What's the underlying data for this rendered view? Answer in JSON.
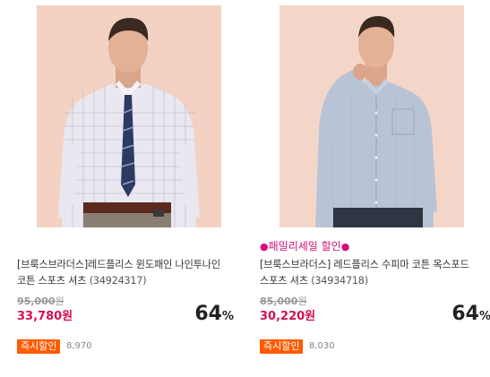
{
  "products": [
    {
      "promo_tag": "",
      "title": "[브룩스브라더스]레드플리스 윈도패인 나인투나인 코튼 스포츠 셔츠",
      "code": "(34924317)",
      "original_price": "95,000",
      "original_currency": "원",
      "sale_price": "33,780원",
      "discount_value": "64",
      "discount_unit": "%",
      "badge": "즉시할인",
      "review_count": "8,970",
      "image_desc": "man-in-check-shirt-and-tie"
    },
    {
      "promo_tag": "패밀리세일 할인",
      "promo_dot": "●",
      "title": "[브룩스브라더스] 레드플리스 수피마 코튼 옥스포드 스포츠 셔츠",
      "code": "(34934718)",
      "original_price": "85,000",
      "original_currency": "원",
      "sale_price": "30,220원",
      "discount_value": "64",
      "discount_unit": "%",
      "badge": "즉시할인",
      "review_count": "8,030",
      "image_desc": "man-in-blue-oxford-shirt"
    }
  ],
  "colors": {
    "sale_price": "#d60f4f",
    "promo": "#d60f7c",
    "badge_bg": "#ff5a00",
    "image_bg": "#f4d4c6"
  }
}
